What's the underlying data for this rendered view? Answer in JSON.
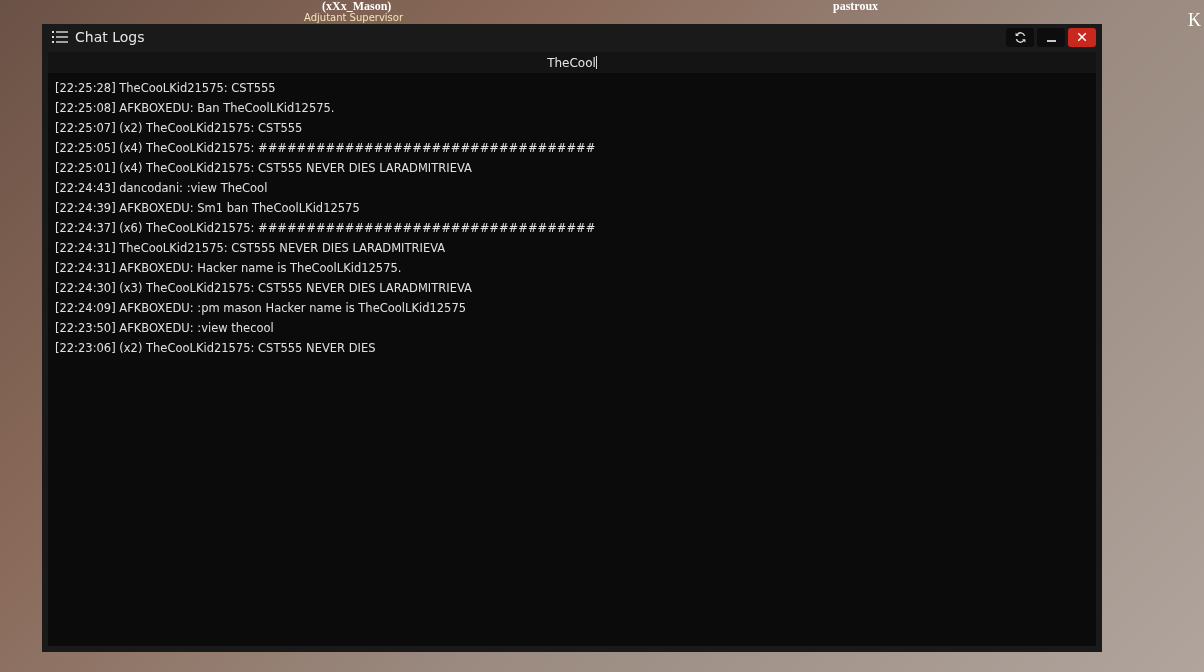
{
  "scene_labels": [
    {
      "text": "(xXx_Mason)",
      "kind": "name"
    },
    {
      "text": "Adjutant Supervisor",
      "kind": "role"
    },
    {
      "text": "pastroux",
      "kind": "name"
    },
    {
      "text": "K",
      "kind": "edge"
    }
  ],
  "window": {
    "title": "Chat Logs"
  },
  "search": {
    "value": "TheCool"
  },
  "log_lines": [
    "[22:25:28] TheCooLKid21575: CST555",
    "[22:25:08] AFKBOXEDU: Ban TheCoolLKid12575.",
    "[22:25:07] (x2) TheCooLKid21575: CST555",
    "[22:25:05] (x4) TheCooLKid21575: ###################################",
    "[22:25:01] (x4) TheCooLKid21575: CST555 NEVER DIES LARADMITRIEVA",
    "[22:24:43] dancodani: :view TheCool",
    "[22:24:39] AFKBOXEDU: Sm1 ban TheCoolLKid12575",
    "[22:24:37] (x6) TheCooLKid21575: ###################################",
    "[22:24:31] TheCooLKid21575: CST555 NEVER DIES LARADMITRIEVA",
    "[22:24:31] AFKBOXEDU: Hacker name is TheCoolLKid12575.",
    "[22:24:30] (x3) TheCooLKid21575: CST555 NEVER DIES LARADMITRIEVA",
    "[22:24:09] AFKBOXEDU: :pm mason Hacker name is TheCoolLKid12575",
    "[22:23:50] AFKBOXEDU: :view thecool",
    "[22:23:06] (x2) TheCooLKid21575: CST555 NEVER DIES"
  ]
}
